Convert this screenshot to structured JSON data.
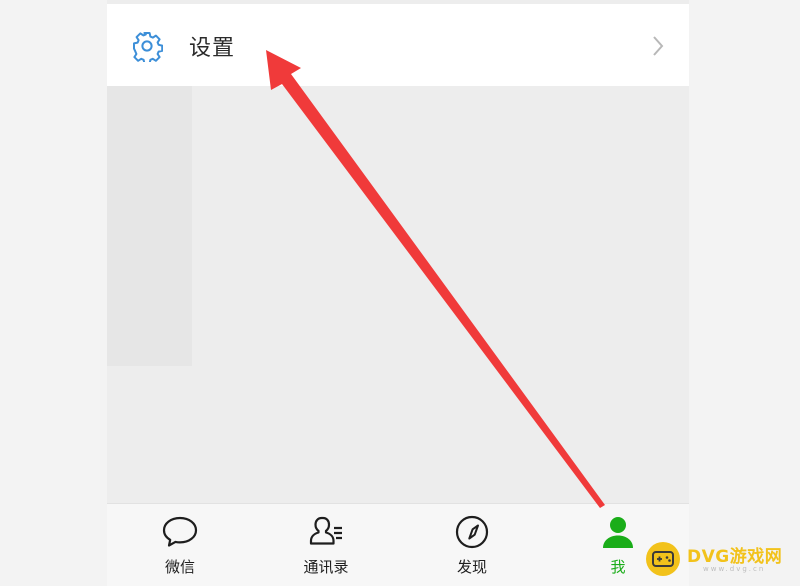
{
  "settings": {
    "label": "设置",
    "icon": "gear-icon",
    "chevron": "chevron-right-icon"
  },
  "tabbar": {
    "tabs": [
      {
        "label": "微信",
        "icon": "chat-bubble-icon",
        "active": false
      },
      {
        "label": "通讯录",
        "icon": "contacts-icon",
        "active": false
      },
      {
        "label": "发现",
        "icon": "compass-icon",
        "active": false
      },
      {
        "label": "我",
        "icon": "person-icon",
        "active": true
      }
    ],
    "active_color": "#1aad19"
  },
  "annotation": {
    "arrow_color": "#f03a3a"
  },
  "watermark": {
    "text": "DVG游戏网",
    "sub": "www.dvg.cn"
  }
}
